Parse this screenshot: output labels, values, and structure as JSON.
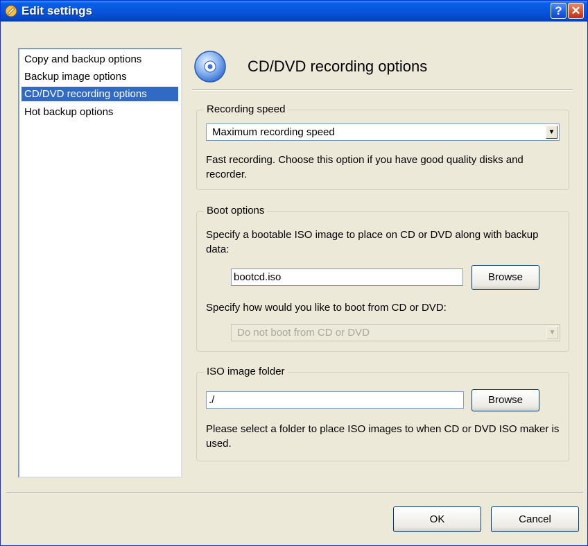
{
  "window": {
    "title": "Edit settings"
  },
  "titlebar": {
    "help": "?",
    "close": "✕"
  },
  "sidebar": {
    "items": [
      {
        "label": "Copy and backup options"
      },
      {
        "label": "Backup image options"
      },
      {
        "label": "CD/DVD recording options",
        "selected": true
      },
      {
        "label": "Hot backup options"
      }
    ]
  },
  "page": {
    "title": "CD/DVD recording options"
  },
  "recording_speed": {
    "legend": "Recording speed",
    "selected": "Maximum recording speed",
    "description": "Fast recording. Choose this option if you have good quality disks and recorder."
  },
  "boot_options": {
    "legend": "Boot options",
    "iso_label": "Specify a bootable ISO image to place on CD or DVD along with backup data:",
    "iso_value": "bootcd.iso",
    "browse_label": "Browse",
    "boot_label": "Specify how would you like to boot from CD or DVD:",
    "boot_selected": "Do not boot from CD or DVD"
  },
  "iso_folder": {
    "legend": "ISO image folder",
    "path_value": "./",
    "browse_label": "Browse",
    "description": "Please select a folder to place ISO images to when CD or DVD ISO maker is used."
  },
  "buttons": {
    "ok": "OK",
    "cancel": "Cancel"
  },
  "colors": {
    "titlebar": "#0855dd",
    "selection": "#316ac5",
    "face": "#ece9d8"
  }
}
